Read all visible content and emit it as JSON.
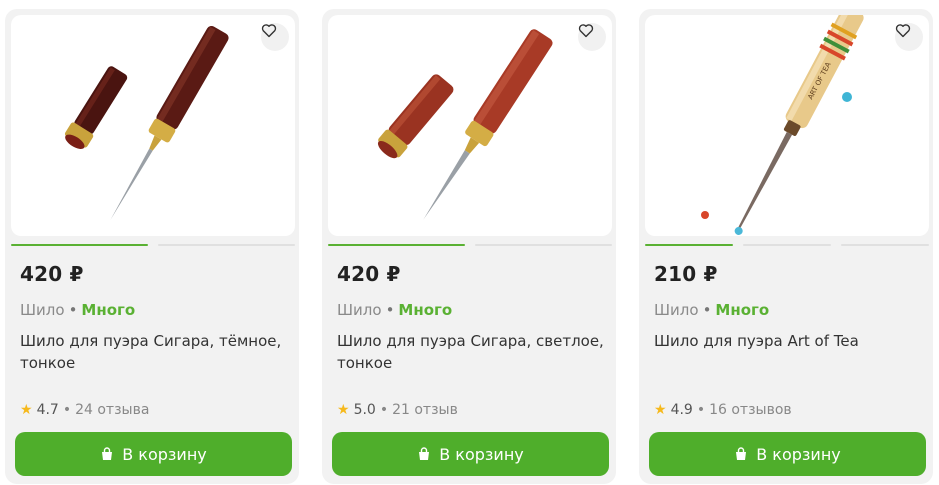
{
  "products": [
    {
      "price": "420 ₽",
      "category": "Шило",
      "stock": "Много",
      "title": "Шило для пуэра Сигара, тёмное, тонкое",
      "rating": "4.7",
      "reviews": "24 отзыва",
      "button_label": "В корзину",
      "slides": 2,
      "active_slide": 1,
      "wood_color": "#5a1a14"
    },
    {
      "price": "420 ₽",
      "category": "Шило",
      "stock": "Много",
      "title": "Шило для пуэра Сигара, светлое, тонкое",
      "rating": "5.0",
      "reviews": "21 отзыв",
      "button_label": "В корзину",
      "slides": 2,
      "active_slide": 1,
      "wood_color": "#9a3321"
    },
    {
      "price": "210 ₽",
      "category": "Шило",
      "stock": "Много",
      "title": "Шило для пуэра Art of Tea",
      "rating": "4.9",
      "reviews": "16 отзывов",
      "button_label": "В корзину",
      "slides": 3,
      "active_slide": 1,
      "wood_color": "#e8c98a"
    }
  ],
  "colors": {
    "accent": "#4fae2b",
    "stock_green": "#5ab133",
    "star": "#f6b91c",
    "card_bg": "#f2f2f2"
  },
  "icons": {
    "favorite": "heart-outline-icon",
    "cart": "shopping-bag-icon",
    "rating": "star-icon"
  },
  "image_labels": {
    "engraving": "ART OF TEA"
  }
}
